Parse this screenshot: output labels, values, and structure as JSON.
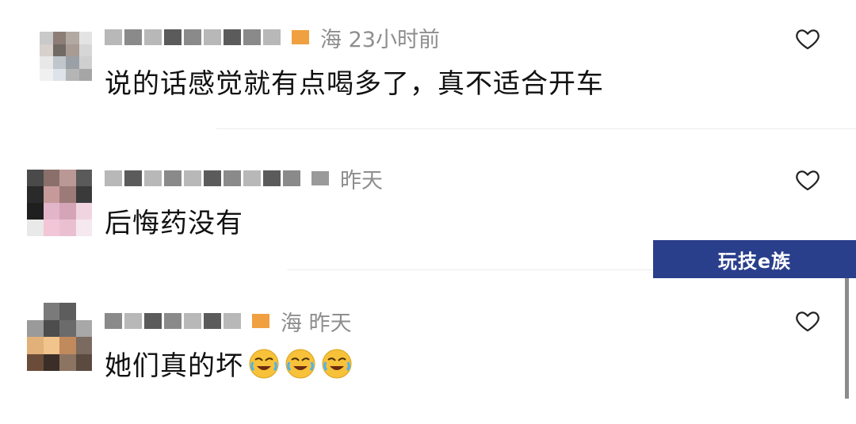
{
  "comments": [
    {
      "location_time": "海 23小时前",
      "text": "说的话感觉就有点喝多了，真不适合开车",
      "emojis": []
    },
    {
      "location_time": "昨天",
      "text": "后悔药没有",
      "emojis": []
    },
    {
      "location_time": "海 昨天",
      "text": "她们真的坏",
      "emojis": [
        "laughing-crying-emoji",
        "laughing-crying-emoji",
        "laughing-crying-emoji"
      ]
    }
  ],
  "watermark": {
    "text": "玩技e族"
  },
  "icons": {
    "like": "heart-outline-icon"
  },
  "colors": {
    "meta_text": "#8e8e8e",
    "watermark_bg": "#2a3f8c",
    "flag": "#f0a040"
  }
}
